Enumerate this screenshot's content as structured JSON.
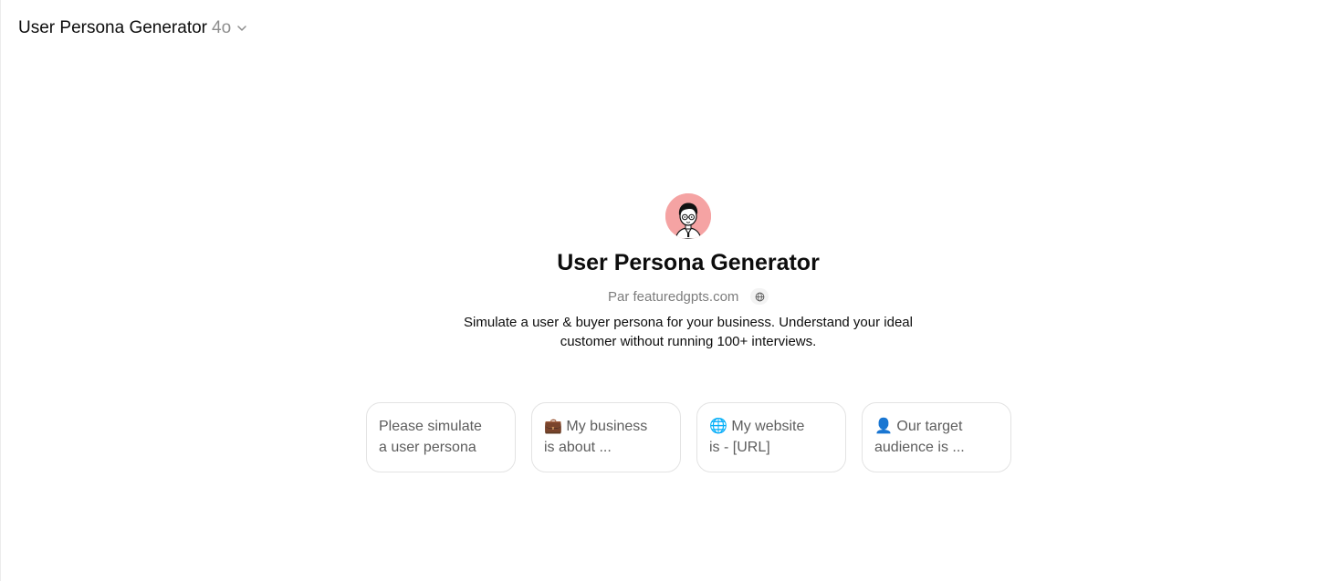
{
  "header": {
    "app_name": "User Persona Generator",
    "model_name": "4o",
    "dropdown_icon": "chevron-down-icon"
  },
  "gpt": {
    "avatar_icon": "persona-avatar-icon",
    "avatar_bg": "#f5a3a3",
    "title": "User Persona Generator",
    "byline": "Par featuredgpts.com",
    "byline_icon": "globe-icon",
    "description": "Simulate a user & buyer persona for your business. Understand your ideal customer without running 100+ interviews."
  },
  "starters": [
    {
      "line1": "Please simulate",
      "line2": "a user persona"
    },
    {
      "line1": "💼 My business",
      "line2": "is about ..."
    },
    {
      "line1": "🌐 My website",
      "line2": "is - [URL]"
    },
    {
      "line1": "👤 Our target",
      "line2": "audience is ..."
    }
  ]
}
